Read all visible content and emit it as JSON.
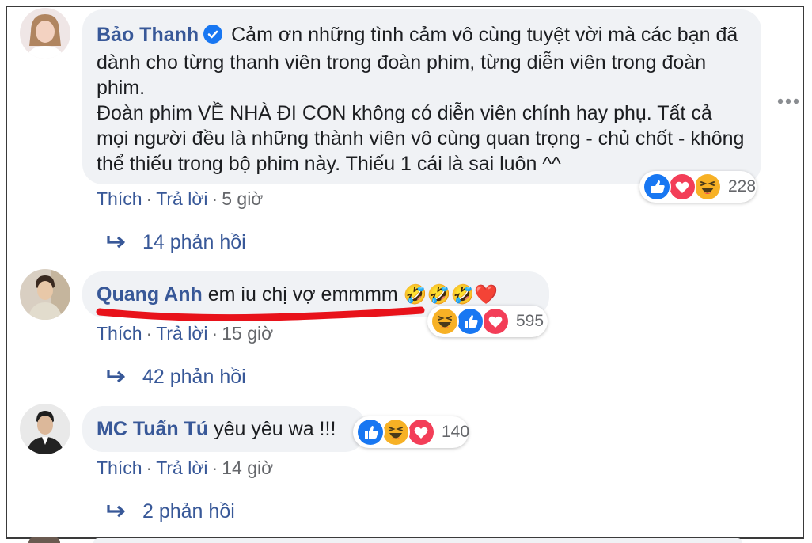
{
  "comments": [
    {
      "author": "Bảo Thanh",
      "text": "Cảm ơn những tình cảm vô cùng tuyệt vời mà các bạn đã dành cho từng thanh viên trong đoàn phim, từng diễn viên trong đoàn phim.\nĐoàn phim VỀ NHÀ ĐI CON không có diễn viên chính hay phụ. Tất cả mọi người đều là những thành viên vô cùng quan trọng - chủ chốt - không thể thiếu trong bộ phim này. Thiếu 1 cái là sai luôn ^^",
      "like": "Thích",
      "reply": "Trả lời",
      "dot": "·",
      "time": "5 giờ",
      "reaction_count": "228",
      "reaction_icons": [
        "like-icon",
        "love-icon",
        "haha-icon"
      ],
      "replies": "14 phản hồi"
    },
    {
      "author": "Quang Anh",
      "text": "em iu chị vợ emmmm",
      "emoji": "🤣🤣🤣❤️",
      "like": "Thích",
      "reply": "Trả lời",
      "dot": "·",
      "time": "15 giờ",
      "reaction_count": "595",
      "reaction_icons": [
        "haha-icon",
        "like-icon",
        "love-icon"
      ],
      "replies": "42 phản hồi"
    },
    {
      "author": "MC Tuấn Tú",
      "text": "yêu yêu wa !!!",
      "like": "Thích",
      "reply": "Trả lời",
      "dot": "·",
      "time": "14 giờ",
      "reaction_count": "140",
      "reaction_icons": [
        "like-icon",
        "haha-icon",
        "love-icon"
      ],
      "replies": "2 phản hồi"
    }
  ],
  "colors": {
    "link": "#385898",
    "bubble": "#f0f2f5",
    "like": "#1877f2",
    "love": "#f33e58",
    "haha": "#f7b125",
    "underline": "#e8121a"
  }
}
